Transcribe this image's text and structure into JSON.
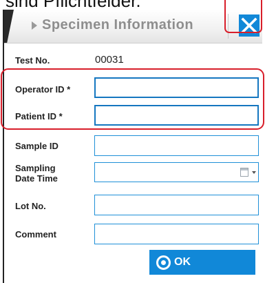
{
  "caption": "sind Pflichtfelder.",
  "dialog": {
    "title": "Specimen Information",
    "close_icon": "close-x-icon"
  },
  "test": {
    "label": "Test No.",
    "value": "00031"
  },
  "fields": {
    "operator_id": {
      "label": "Operator ID *",
      "value": ""
    },
    "patient_id": {
      "label": "Patient ID *",
      "value": ""
    },
    "sample_id": {
      "label": "Sample ID",
      "value": ""
    },
    "sampling_date_time": {
      "label_line1": "Sampling",
      "label_line2": "Date Time",
      "value": "",
      "icon": "calendar-dropdown-icon"
    },
    "lot_no": {
      "label": "Lot No.",
      "value": ""
    },
    "comment": {
      "label": "Comment",
      "value": ""
    }
  },
  "ok_button": {
    "label": "OK",
    "icon": "ok-circle-icon"
  },
  "colors": {
    "accent": "#1188d8",
    "highlight": "#d81e2a",
    "field_border": "#1e8fd8"
  }
}
